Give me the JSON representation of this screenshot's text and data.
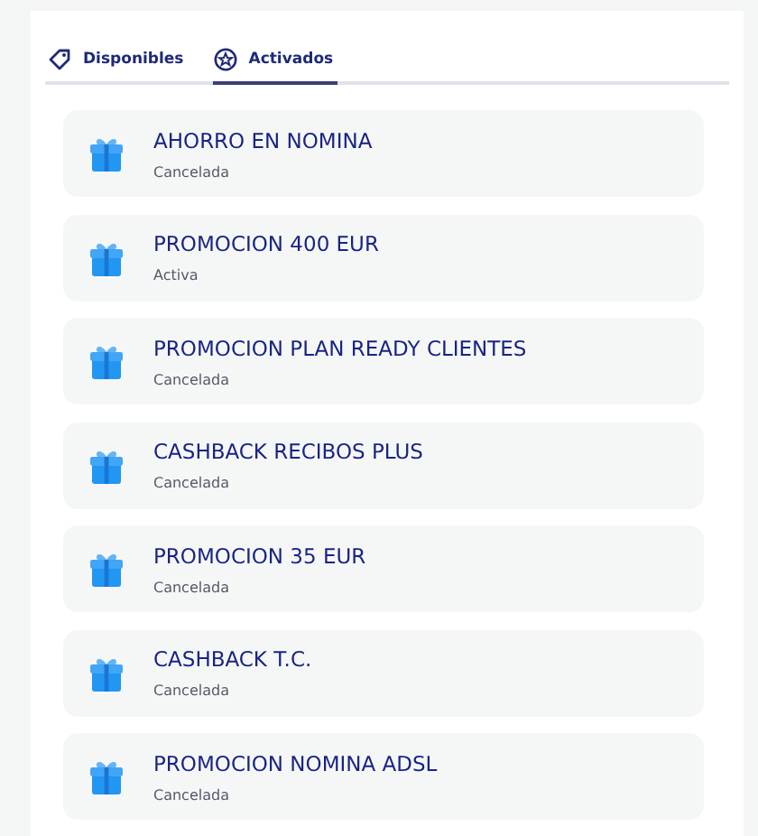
{
  "tabs": [
    {
      "label": "Disponibles",
      "kind": "tag",
      "selected": false
    },
    {
      "label": "Activados",
      "kind": "star",
      "selected": true
    }
  ],
  "promotions": [
    {
      "title": "AHORRO EN NOMINA",
      "status": "Cancelada"
    },
    {
      "title": "PROMOCION 400 EUR",
      "status": "Activa"
    },
    {
      "title": "PROMOCION PLAN READY CLIENTES",
      "status": "Cancelada"
    },
    {
      "title": "CASHBACK RECIBOS PLUS",
      "status": "Cancelada"
    },
    {
      "title": "PROMOCION 35 EUR",
      "status": "Cancelada"
    },
    {
      "title": "CASHBACK T.C.",
      "status": "Cancelada"
    },
    {
      "title": "PROMOCION NOMINA ADSL",
      "status": "Cancelada"
    }
  ]
}
